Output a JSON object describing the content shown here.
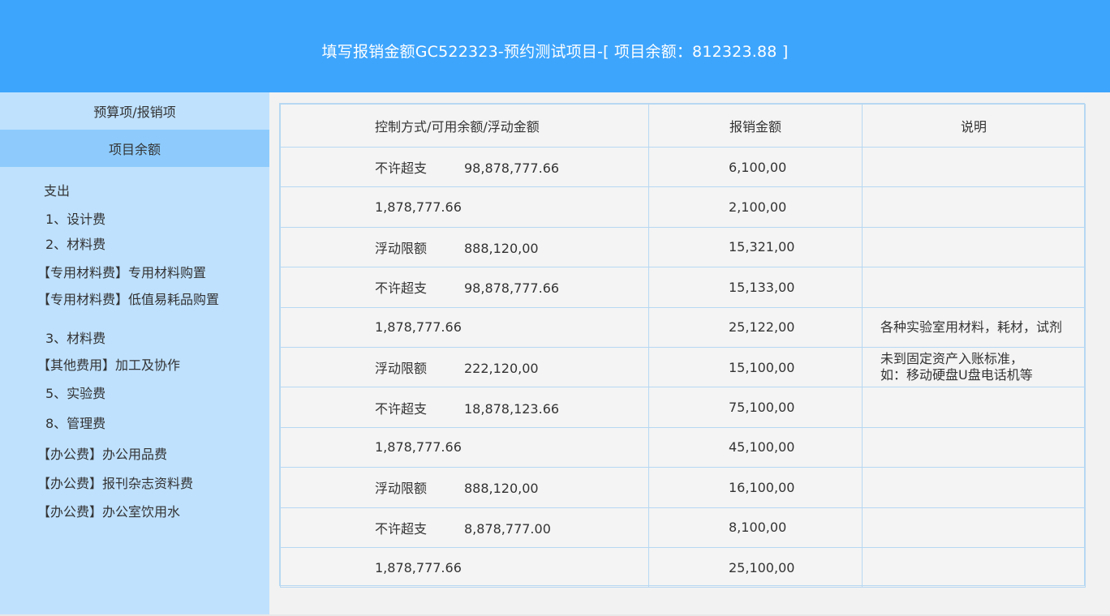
{
  "header": {
    "title": "填写报销金额GC522323-预约测试项目-[ 项目余额：812323.88 ]"
  },
  "sidebar": {
    "tabs": [
      {
        "label": "预算项/报销项"
      },
      {
        "label": "项目余额"
      }
    ],
    "items": [
      {
        "label": "支出"
      },
      {
        "label": "1、设计费"
      },
      {
        "label": "2、材料费"
      },
      {
        "label": "【专用材料费】专用材料购置"
      },
      {
        "label": "【专用材料费】低值易耗品购置"
      },
      {
        "label": "3、材料费"
      },
      {
        "label": "【其他费用】加工及协作"
      },
      {
        "label": "5、实验费"
      },
      {
        "label": "8、管理费"
      },
      {
        "label": "【办公费】办公用品费"
      },
      {
        "label": "【办公费】报刊杂志资料费"
      },
      {
        "label": "【办公费】办公室饮用水"
      }
    ]
  },
  "table": {
    "headers": [
      "控制方式/可用余额/浮动金额",
      "报销金额",
      "说明"
    ],
    "rows": [
      {
        "mode": "不许超支",
        "value": "98,878,777.66",
        "amount": "6,100,00",
        "note": "",
        "note2": ""
      },
      {
        "mode": "1,878,777.66",
        "value": "",
        "amount": "2,100,00",
        "note": "",
        "note2": ""
      },
      {
        "mode": "浮动限额",
        "value": "888,120,00",
        "amount": "15,321,00",
        "note": "",
        "note2": ""
      },
      {
        "mode": "不许超支",
        "value": "98,878,777.66",
        "amount": "15,133,00",
        "note": "",
        "note2": ""
      },
      {
        "mode": "1,878,777.66",
        "value": "",
        "amount": "25,122,00",
        "note": "各种实验室用材料，耗材，试剂",
        "note2": ""
      },
      {
        "mode": "浮动限额",
        "value": "222,120,00",
        "amount": "15,100,00",
        "note": "未到固定资产入账标准，",
        "note2": "如：移动硬盘U盘电话机等"
      },
      {
        "mode": "不许超支",
        "value": "18,878,123.66",
        "amount": "75,100,00",
        "note": "",
        "note2": ""
      },
      {
        "mode": "1,878,777.66",
        "value": "",
        "amount": "45,100,00",
        "note": "",
        "note2": ""
      },
      {
        "mode": "浮动限额",
        "value": "888,120,00",
        "amount": "16,100,00",
        "note": "",
        "note2": ""
      },
      {
        "mode": "不许超支",
        "value": "8,878,777.00",
        "amount": "8,100,00",
        "note": "",
        "note2": ""
      },
      {
        "mode": "1,878,777.66",
        "value": "",
        "amount": "25,100,00",
        "note": "",
        "note2": ""
      }
    ]
  },
  "colors": {
    "header_bg": "#3ea5fc",
    "sidebar_bg": "#bfe1fe",
    "sidebar_active_bg": "#8ecbfc",
    "table_border": "#b7d8f2"
  }
}
